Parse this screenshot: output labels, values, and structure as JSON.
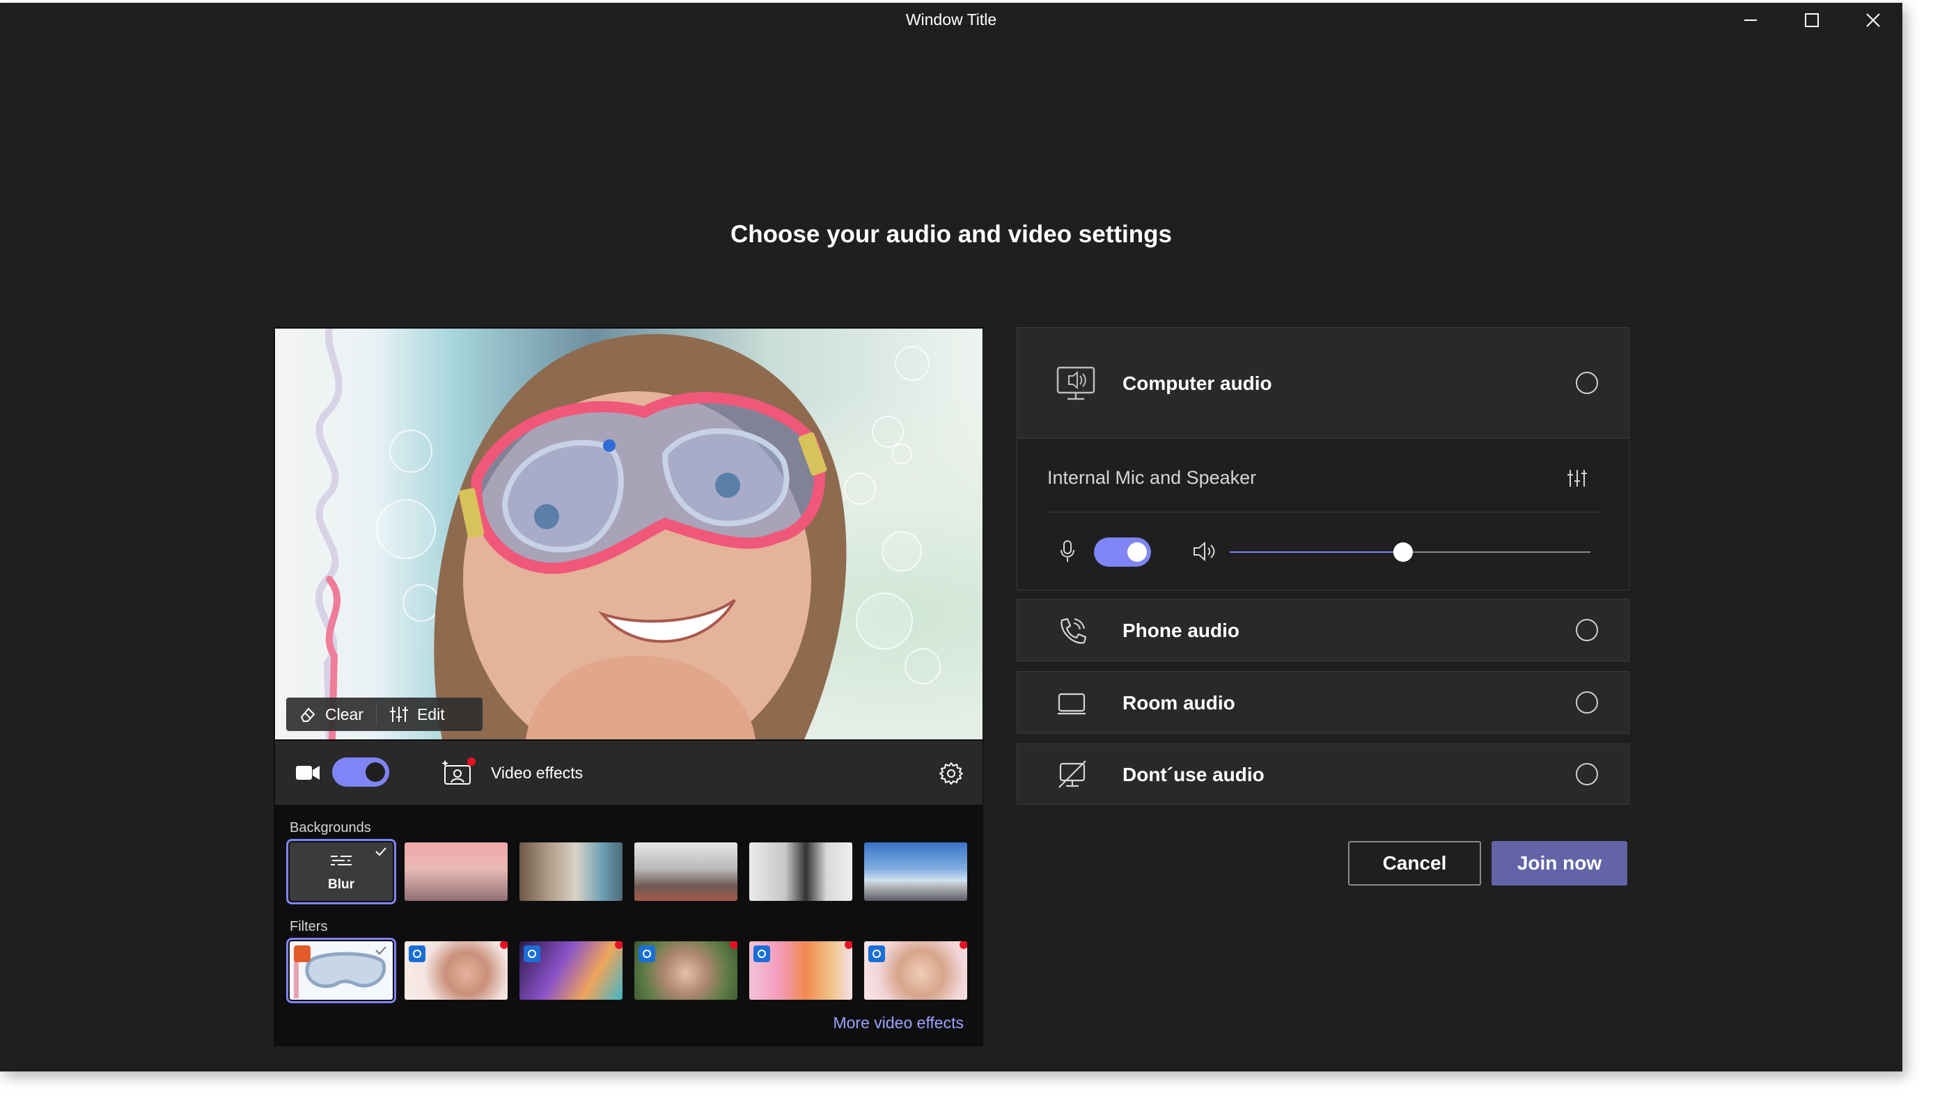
{
  "window": {
    "title": "Window Title"
  },
  "heading": "Choose your audio and video settings",
  "video": {
    "overlay": {
      "clear_label": "Clear",
      "edit_label": "Edit"
    },
    "camera_on": true,
    "effects_label": "Video effects",
    "backgrounds_label": "Backgrounds",
    "blur_label": "Blur",
    "filters_label": "Filters",
    "more_effects_label": "More video effects"
  },
  "audio": {
    "computer_label": "Computer audio",
    "device_name": "Internal Mic and Speaker",
    "mic_on": true,
    "volume": 0.48,
    "phone_label": "Phone audio",
    "room_label": "Room audio",
    "none_label": "Dont´use audio"
  },
  "actions": {
    "cancel_label": "Cancel",
    "join_label": "Join now"
  },
  "colors": {
    "accent": "#7f85f5",
    "join": "#6264a7",
    "link": "#9ea2ff",
    "notify": "#e81123",
    "badge": "#1a6fd6"
  },
  "icons": [
    "minimize-icon",
    "maximize-icon",
    "close-icon",
    "eraser-icon",
    "sliders-icon",
    "video-camera-icon",
    "video-effects-icon",
    "gear-icon",
    "blur-icon",
    "checkmark-icon",
    "computer-audio-icon",
    "microphone-icon",
    "speaker-icon",
    "phone-audio-icon",
    "room-audio-icon",
    "no-audio-icon"
  ]
}
